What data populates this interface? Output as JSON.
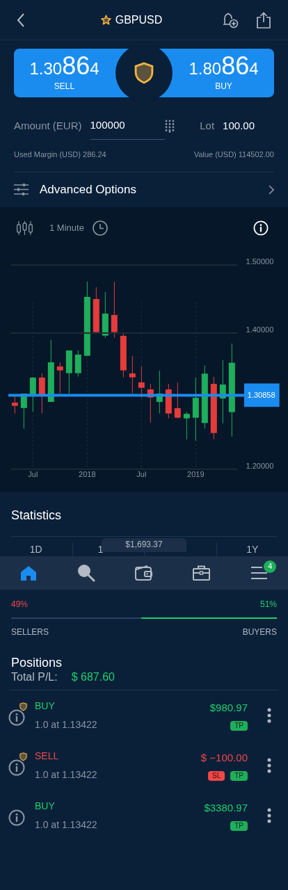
{
  "header": {
    "title": "GBPUSD",
    "favorite": true
  },
  "quote": {
    "sell": {
      "prefix": "1.30",
      "pips": "86",
      "suffix": "4",
      "label": "SELL"
    },
    "buy": {
      "prefix": "1.80",
      "pips": "86",
      "suffix": "4",
      "label": "BUY"
    }
  },
  "order": {
    "amount_label": "Amount (EUR)",
    "amount_value": "100000",
    "lot_label": "Lot",
    "lot_value": "100.00",
    "used_margin": "Used Margin (USD) 286.24",
    "value": "Value (USD) 114502.00"
  },
  "advanced_options": "Advanced Options",
  "chart": {
    "interval": "1 Minute",
    "chart_data": {
      "type": "candlestick",
      "categories": [
        null,
        null,
        "Jul",
        null,
        null,
        null,
        null,
        null,
        "2018",
        null,
        null,
        null,
        null,
        null,
        "Jul",
        null,
        null,
        null,
        null,
        null,
        "2019",
        null,
        null,
        null,
        null
      ],
      "ohlc": [
        [
          1.2978,
          1.308,
          1.2818,
          1.293
        ],
        [
          1.2899,
          1.3111,
          1.2593,
          1.3111
        ],
        [
          1.3084,
          1.3356,
          1.2845,
          1.3346
        ],
        [
          1.3346,
          1.3408,
          1.2818,
          1.3084
        ],
        [
          1.2988,
          1.3899,
          1.2988,
          1.3571
        ],
        [
          1.351,
          1.3571,
          1.3114,
          1.3452
        ],
        [
          1.3411,
          1.3745,
          1.3114,
          1.3745
        ],
        [
          1.3411,
          1.3745,
          1.336,
          1.3684
        ],
        [
          1.3667,
          1.4758,
          1.3667,
          1.4533
        ],
        [
          1.4502,
          1.4676,
          1.4015,
          1.4015
        ],
        [
          1.3963,
          1.4604,
          1.3933,
          1.4287
        ],
        [
          1.4267,
          1.4758,
          1.3933,
          1.4015
        ],
        [
          1.396,
          1.4011,
          1.335,
          1.3452
        ],
        [
          1.3408,
          1.3663,
          1.3114,
          1.335
        ],
        [
          1.3275,
          1.351,
          1.3053,
          1.3196
        ],
        [
          1.3172,
          1.3254,
          1.2685,
          1.3053
        ],
        [
          1.2988,
          1.3448,
          1.2818,
          1.3111
        ],
        [
          1.3172,
          1.3254,
          1.2746,
          1.2818
        ],
        [
          1.2896,
          1.3275,
          1.2746,
          1.2756
        ],
        [
          1.2746,
          1.2845,
          1.2439,
          1.2814
        ],
        [
          1.2756,
          1.3346,
          1.2419,
          1.3049
        ],
        [
          1.2678,
          1.3523,
          1.2596,
          1.3404
        ],
        [
          1.3254,
          1.3356,
          1.2439,
          1.2531
        ],
        [
          1.3039,
          1.3602,
          1.2674,
          1.3244
        ],
        [
          1.2838,
          1.3847,
          1.2477,
          1.3564
        ]
      ],
      "ylim": [
        1.2,
        1.5
      ],
      "grid": true,
      "yticks": [
        {
          "value": 1.5,
          "label": "1.50000"
        },
        {
          "value": 1.4,
          "label": "1.40000"
        },
        {
          "value": 1.2,
          "label": "1.20000"
        }
      ],
      "ref_lines": [
        {
          "axis": "y",
          "value": 1.4
        },
        {
          "axis": "y",
          "value": 1.30858,
          "label": "1.30858"
        }
      ]
    }
  },
  "statistics": {
    "title": "Statistics",
    "tabs": [
      {
        "label": "1D"
      },
      {
        "label": "1"
      },
      {
        "label": "1Y"
      }
    ]
  },
  "nav": {
    "balance": "$1,693.37",
    "items": [
      {
        "kind": "home",
        "selected": true
      },
      {
        "kind": "search",
        "selected": false
      },
      {
        "kind": "wallet",
        "selected": false
      },
      {
        "kind": "briefcase",
        "selected": false
      },
      {
        "kind": "menu",
        "selected": false,
        "badge": "4"
      }
    ]
  },
  "sentiment": {
    "sellers_pct": "49%",
    "buyers_pct": "51%",
    "level": 0.51,
    "sellers_label": "SELLERS",
    "buyers_label": "BUYERS"
  },
  "positions": {
    "title": "Positions",
    "total_label": "Total P/L:",
    "total_value": "$ 687.60",
    "items": [
      {
        "kind": "buy",
        "side": "BUY",
        "protected": true,
        "detail": "1.0 at 1.13422",
        "pl": "$980.97",
        "tags": [
          {
            "kind": "tp",
            "label": "TP"
          }
        ]
      },
      {
        "kind": "sell",
        "side": "SELL",
        "protected": true,
        "detail": "1.0 at 1.13422",
        "pl": "$ −100.00",
        "tags": [
          {
            "kind": "sl",
            "label": "SL"
          },
          {
            "kind": "tp",
            "label": "TP"
          }
        ]
      },
      {
        "kind": "buy",
        "side": "BUY",
        "protected": false,
        "detail": "1.0 at 1.13422",
        "pl": "$3380.97",
        "tags": [
          {
            "kind": "tp",
            "label": "TP"
          }
        ]
      }
    ]
  }
}
